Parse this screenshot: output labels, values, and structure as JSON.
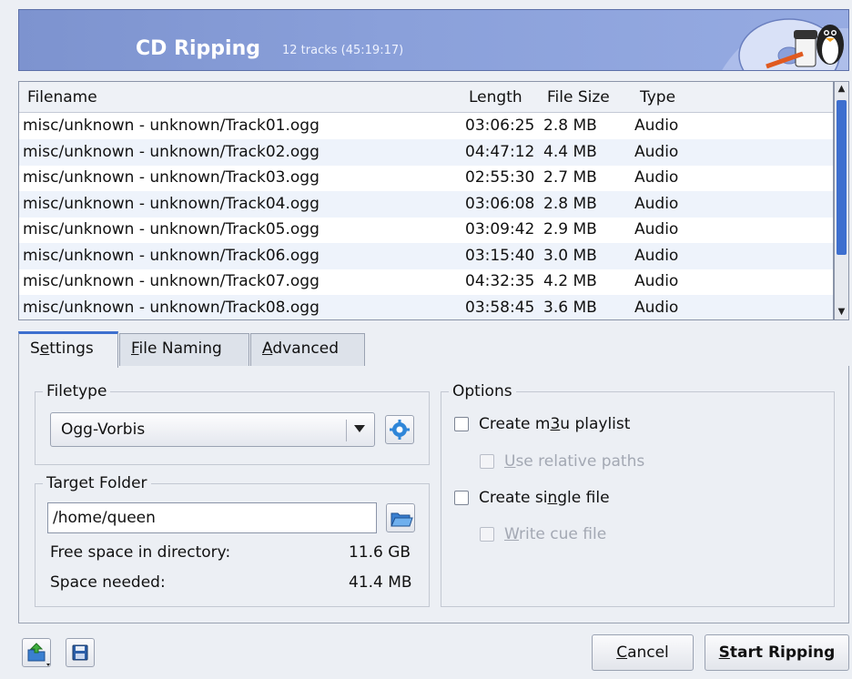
{
  "header": {
    "title": "CD Ripping",
    "subtitle": "12 tracks (45:19:17)"
  },
  "tracklist": {
    "columns": [
      "Filename",
      "Length",
      "File Size",
      "Type"
    ],
    "rows": [
      [
        "misc/unknown - unknown/Track01.ogg",
        "03:06:25",
        "2.8 MB",
        "Audio"
      ],
      [
        "misc/unknown - unknown/Track02.ogg",
        "04:47:12",
        "4.4 MB",
        "Audio"
      ],
      [
        "misc/unknown - unknown/Track03.ogg",
        "02:55:30",
        "2.7 MB",
        "Audio"
      ],
      [
        "misc/unknown - unknown/Track04.ogg",
        "03:06:08",
        "2.8 MB",
        "Audio"
      ],
      [
        "misc/unknown - unknown/Track05.ogg",
        "03:09:42",
        "2.9 MB",
        "Audio"
      ],
      [
        "misc/unknown - unknown/Track06.ogg",
        "03:15:40",
        "3.0 MB",
        "Audio"
      ],
      [
        "misc/unknown - unknown/Track07.ogg",
        "04:32:35",
        "4.2 MB",
        "Audio"
      ],
      [
        "misc/unknown - unknown/Track08.ogg",
        "03:58:45",
        "3.6 MB",
        "Audio"
      ]
    ]
  },
  "tabs": {
    "settings": {
      "pre": "S",
      "mn": "e",
      "post": "ttings"
    },
    "file_naming": {
      "pre": "",
      "mn": "F",
      "post": "ile Naming"
    },
    "advanced": {
      "pre": "",
      "mn": "A",
      "post": "dvanced"
    }
  },
  "filetype": {
    "legend": "Filetype",
    "selected": "Ogg-Vorbis"
  },
  "target": {
    "legend": "Target Folder",
    "path": "/home/queen",
    "free_label": "Free space in directory:",
    "free_value": "11.6 GB",
    "needed_label": "Space needed:",
    "needed_value": "41.4 MB"
  },
  "options": {
    "legend": "Options",
    "m3u": {
      "pre": "Create m",
      "mn": "3",
      "post": "u playlist"
    },
    "relative": {
      "pre": "",
      "mn": "U",
      "post": "se relative paths"
    },
    "single": {
      "pre": "Create si",
      "mn": "n",
      "post": "gle file"
    },
    "cue": {
      "pre": "",
      "mn": "W",
      "post": "rite cue file"
    }
  },
  "buttons": {
    "cancel": {
      "pre": "",
      "mn": "C",
      "post": "ancel"
    },
    "start": {
      "pre": "",
      "mn": "S",
      "post": "tart Ripping"
    }
  },
  "colors": {
    "banner": "#8aa0da",
    "accent": "#3d6fcf",
    "alt_row": "#eef3fb"
  },
  "icons": [
    "cd-penguin-banner-icon",
    "configure-gear-icon",
    "open-folder-icon",
    "load-profile-icon",
    "save-icon"
  ]
}
